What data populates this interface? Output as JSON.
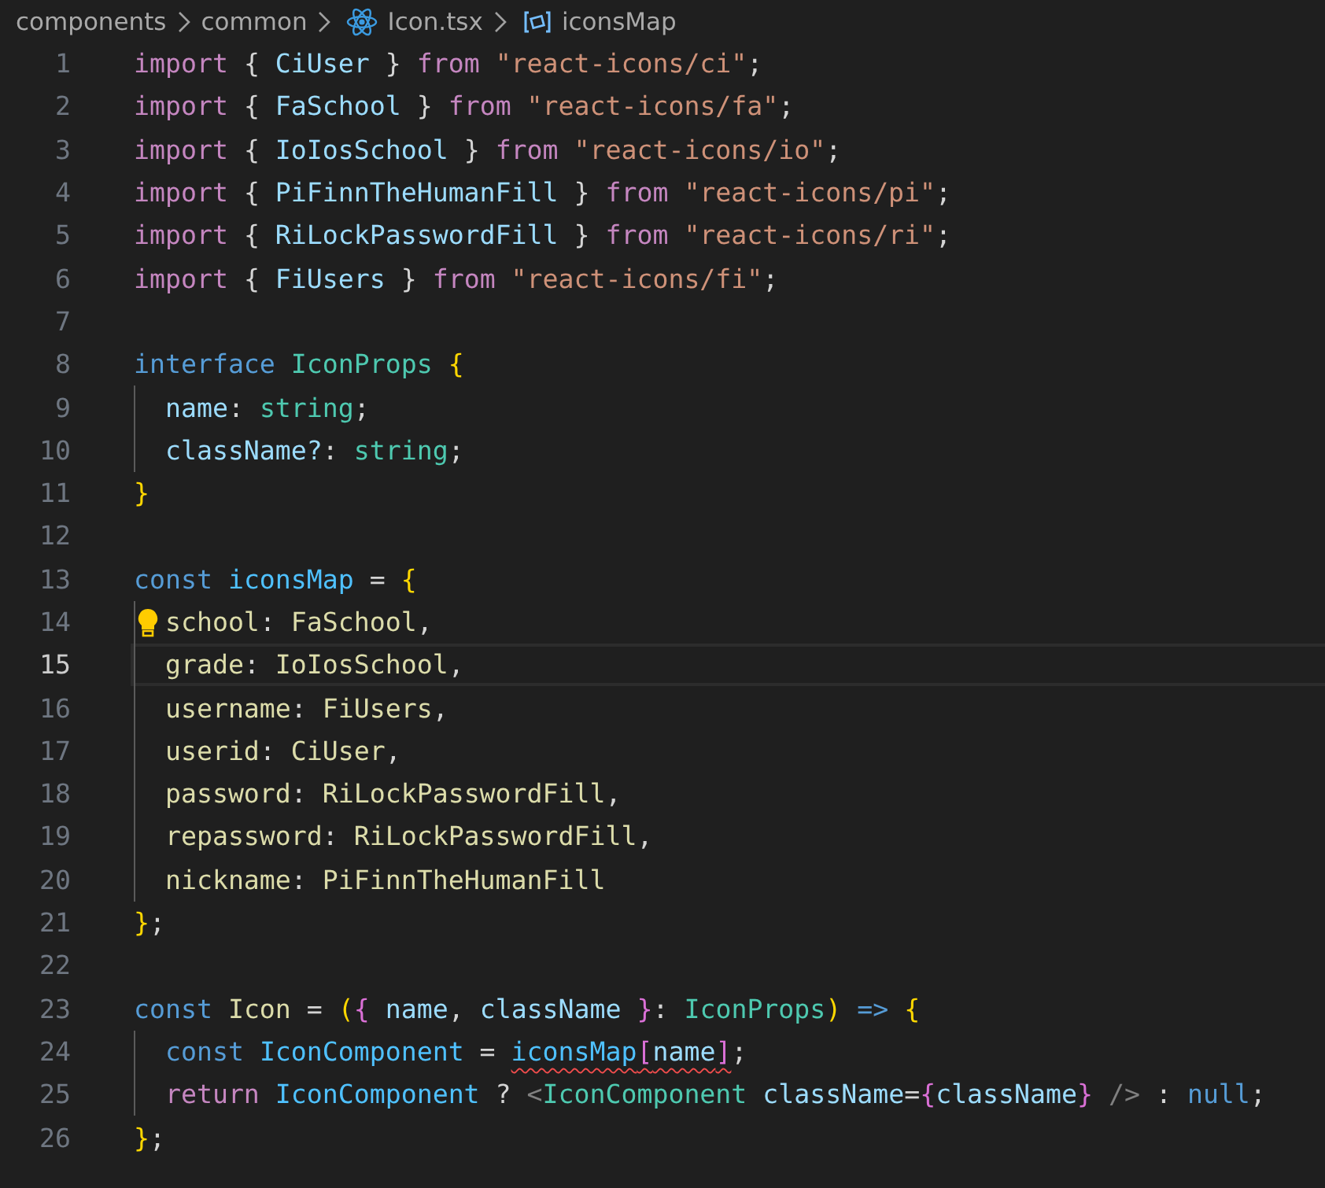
{
  "breadcrumb": [
    {
      "text": "components",
      "kind": "folder"
    },
    {
      "text": "common",
      "kind": "folder"
    },
    {
      "text": "Icon.tsx",
      "kind": "react-file"
    },
    {
      "text": "iconsMap",
      "kind": "symbol"
    }
  ],
  "lines": [
    {
      "number": "1",
      "selected": false,
      "lightbulb": false,
      "tokens": [
        {
          "text": "import ",
          "kind": "keyword"
        },
        {
          "text": "{ ",
          "kind": "plain"
        },
        {
          "text": "CiUser",
          "kind": "variable"
        },
        {
          "text": " } ",
          "kind": "plain"
        },
        {
          "text": "from ",
          "kind": "keyword"
        },
        {
          "text": "\"react-icons/ci\"",
          "kind": "string"
        },
        {
          "text": ";",
          "kind": "plain"
        }
      ]
    },
    {
      "number": "2",
      "selected": false,
      "lightbulb": false,
      "tokens": [
        {
          "text": "import ",
          "kind": "keyword"
        },
        {
          "text": "{ ",
          "kind": "plain"
        },
        {
          "text": "FaSchool",
          "kind": "variable"
        },
        {
          "text": " } ",
          "kind": "plain"
        },
        {
          "text": "from ",
          "kind": "keyword"
        },
        {
          "text": "\"react-icons/fa\"",
          "kind": "string"
        },
        {
          "text": ";",
          "kind": "plain"
        }
      ]
    },
    {
      "number": "3",
      "selected": false,
      "lightbulb": false,
      "tokens": [
        {
          "text": "import ",
          "kind": "keyword"
        },
        {
          "text": "{ ",
          "kind": "plain"
        },
        {
          "text": "IoIosSchool",
          "kind": "variable"
        },
        {
          "text": " } ",
          "kind": "plain"
        },
        {
          "text": "from ",
          "kind": "keyword"
        },
        {
          "text": "\"react-icons/io\"",
          "kind": "string"
        },
        {
          "text": ";",
          "kind": "plain"
        }
      ]
    },
    {
      "number": "4",
      "selected": false,
      "lightbulb": false,
      "tokens": [
        {
          "text": "import ",
          "kind": "keyword"
        },
        {
          "text": "{ ",
          "kind": "plain"
        },
        {
          "text": "PiFinnTheHumanFill",
          "kind": "variable"
        },
        {
          "text": " } ",
          "kind": "plain"
        },
        {
          "text": "from ",
          "kind": "keyword"
        },
        {
          "text": "\"react-icons/pi\"",
          "kind": "string"
        },
        {
          "text": ";",
          "kind": "plain"
        }
      ]
    },
    {
      "number": "5",
      "selected": false,
      "lightbulb": false,
      "tokens": [
        {
          "text": "import ",
          "kind": "keyword"
        },
        {
          "text": "{ ",
          "kind": "plain"
        },
        {
          "text": "RiLockPasswordFill",
          "kind": "variable"
        },
        {
          "text": " } ",
          "kind": "plain"
        },
        {
          "text": "from ",
          "kind": "keyword"
        },
        {
          "text": "\"react-icons/ri\"",
          "kind": "string"
        },
        {
          "text": ";",
          "kind": "plain"
        }
      ]
    },
    {
      "number": "6",
      "selected": false,
      "lightbulb": false,
      "tokens": [
        {
          "text": "import ",
          "kind": "keyword"
        },
        {
          "text": "{ ",
          "kind": "plain"
        },
        {
          "text": "FiUsers",
          "kind": "variable"
        },
        {
          "text": " } ",
          "kind": "plain"
        },
        {
          "text": "from ",
          "kind": "keyword"
        },
        {
          "text": "\"react-icons/fi\"",
          "kind": "string"
        },
        {
          "text": ";",
          "kind": "plain"
        }
      ]
    },
    {
      "number": "7",
      "selected": false,
      "lightbulb": false
    },
    {
      "number": "8",
      "selected": false,
      "lightbulb": false,
      "tokens": [
        {
          "text": "interface ",
          "kind": "storage"
        },
        {
          "text": "IconProps ",
          "kind": "type"
        },
        {
          "text": "{",
          "kind": "brace"
        }
      ]
    },
    {
      "number": "9",
      "selected": false,
      "lightbulb": false,
      "tokens": [
        {
          "text": "  name",
          "kind": "variable"
        },
        {
          "text": ": ",
          "kind": "plain"
        },
        {
          "text": "string",
          "kind": "type"
        },
        {
          "text": ";",
          "kind": "plain"
        }
      ]
    },
    {
      "number": "10",
      "selected": false,
      "lightbulb": false,
      "tokens": [
        {
          "text": "  className?",
          "kind": "variable"
        },
        {
          "text": ": ",
          "kind": "plain"
        },
        {
          "text": "string",
          "kind": "type"
        },
        {
          "text": ";",
          "kind": "plain"
        }
      ]
    },
    {
      "number": "11",
      "selected": false,
      "lightbulb": false,
      "tokens": [
        {
          "text": "}",
          "kind": "brace"
        }
      ]
    },
    {
      "number": "12",
      "selected": false,
      "lightbulb": false
    },
    {
      "number": "13",
      "selected": false,
      "lightbulb": false,
      "tokens": [
        {
          "text": "const ",
          "kind": "storage"
        },
        {
          "text": "iconsMap",
          "kind": "constant"
        },
        {
          "text": " = ",
          "kind": "plain"
        },
        {
          "text": "{",
          "kind": "brace"
        }
      ]
    },
    {
      "number": "14",
      "selected": false,
      "lightbulb": true,
      "tokens": [
        {
          "text": "  school",
          "kind": "function"
        },
        {
          "text": ": ",
          "kind": "plain"
        },
        {
          "text": "FaSchool",
          "kind": "function"
        },
        {
          "text": ",",
          "kind": "plain"
        }
      ]
    },
    {
      "number": "15",
      "selected": true,
      "lightbulb": false,
      "tokens": [
        {
          "text": "  grade",
          "kind": "function"
        },
        {
          "text": ": ",
          "kind": "plain"
        },
        {
          "text": "IoIosSchool",
          "kind": "function"
        },
        {
          "text": ",",
          "kind": "plain"
        }
      ]
    },
    {
      "number": "16",
      "selected": false,
      "lightbulb": false,
      "tokens": [
        {
          "text": "  username",
          "kind": "function"
        },
        {
          "text": ": ",
          "kind": "plain"
        },
        {
          "text": "FiUsers",
          "kind": "function"
        },
        {
          "text": ",",
          "kind": "plain"
        }
      ]
    },
    {
      "number": "17",
      "selected": false,
      "lightbulb": false,
      "tokens": [
        {
          "text": "  userid",
          "kind": "function"
        },
        {
          "text": ": ",
          "kind": "plain"
        },
        {
          "text": "CiUser",
          "kind": "function"
        },
        {
          "text": ",",
          "kind": "plain"
        }
      ]
    },
    {
      "number": "18",
      "selected": false,
      "lightbulb": false,
      "tokens": [
        {
          "text": "  password",
          "kind": "function"
        },
        {
          "text": ": ",
          "kind": "plain"
        },
        {
          "text": "RiLockPasswordFill",
          "kind": "function"
        },
        {
          "text": ",",
          "kind": "plain"
        }
      ]
    },
    {
      "number": "19",
      "selected": false,
      "lightbulb": false,
      "tokens": [
        {
          "text": "  repassword",
          "kind": "function"
        },
        {
          "text": ": ",
          "kind": "plain"
        },
        {
          "text": "RiLockPasswordFill",
          "kind": "function"
        },
        {
          "text": ",",
          "kind": "plain"
        }
      ]
    },
    {
      "number": "20",
      "selected": false,
      "lightbulb": false,
      "tokens": [
        {
          "text": "  nickname",
          "kind": "function"
        },
        {
          "text": ": ",
          "kind": "plain"
        },
        {
          "text": "PiFinnTheHumanFill",
          "kind": "function"
        }
      ]
    },
    {
      "number": "21",
      "selected": false,
      "lightbulb": false,
      "tokens": [
        {
          "text": "}",
          "kind": "brace"
        },
        {
          "text": ";",
          "kind": "plain"
        }
      ]
    },
    {
      "number": "22",
      "selected": false,
      "lightbulb": false
    },
    {
      "number": "23",
      "selected": false,
      "lightbulb": false,
      "tokens": [
        {
          "text": "const ",
          "kind": "storage"
        },
        {
          "text": "Icon",
          "kind": "function"
        },
        {
          "text": " = ",
          "kind": "plain"
        },
        {
          "text": "(",
          "kind": "brace"
        },
        {
          "text": "{ ",
          "kind": "brace2"
        },
        {
          "text": "name",
          "kind": "variable"
        },
        {
          "text": ", ",
          "kind": "plain"
        },
        {
          "text": "className ",
          "kind": "variable"
        },
        {
          "text": "}",
          "kind": "brace2"
        },
        {
          "text": ": ",
          "kind": "plain"
        },
        {
          "text": "IconProps",
          "kind": "type"
        },
        {
          "text": ")",
          "kind": "brace"
        },
        {
          "text": " => ",
          "kind": "storage"
        },
        {
          "text": "{",
          "kind": "brace"
        }
      ]
    },
    {
      "number": "24",
      "selected": false,
      "lightbulb": false,
      "tokens": [
        {
          "text": "  const ",
          "kind": "storage"
        },
        {
          "text": "IconComponent",
          "kind": "constant"
        },
        {
          "text": " = ",
          "kind": "plain"
        },
        {
          "text": "iconsMap",
          "kind": "constant",
          "error": true
        },
        {
          "text": "[",
          "kind": "brace2",
          "error": true
        },
        {
          "text": "name",
          "kind": "variable",
          "error": true
        },
        {
          "text": "]",
          "kind": "brace2",
          "error": true
        },
        {
          "text": ";",
          "kind": "plain"
        }
      ]
    },
    {
      "number": "25",
      "selected": false,
      "lightbulb": false,
      "tokens": [
        {
          "text": "  return ",
          "kind": "keyword"
        },
        {
          "text": "IconComponent",
          "kind": "constant"
        },
        {
          "text": " ? ",
          "kind": "plain"
        },
        {
          "text": "<",
          "kind": "tag"
        },
        {
          "text": "IconComponent ",
          "kind": "type"
        },
        {
          "text": "className",
          "kind": "variable"
        },
        {
          "text": "=",
          "kind": "plain"
        },
        {
          "text": "{",
          "kind": "brace2"
        },
        {
          "text": "className",
          "kind": "variable"
        },
        {
          "text": "}",
          "kind": "brace2"
        },
        {
          "text": " /> ",
          "kind": "tag"
        },
        {
          "text": ": ",
          "kind": "plain"
        },
        {
          "text": "null",
          "kind": "storage"
        },
        {
          "text": ";",
          "kind": "plain"
        }
      ]
    },
    {
      "number": "26",
      "selected": false,
      "lightbulb": false,
      "tokens": [
        {
          "text": "}",
          "kind": "brace"
        },
        {
          "text": ";",
          "kind": "plain"
        }
      ]
    }
  ]
}
